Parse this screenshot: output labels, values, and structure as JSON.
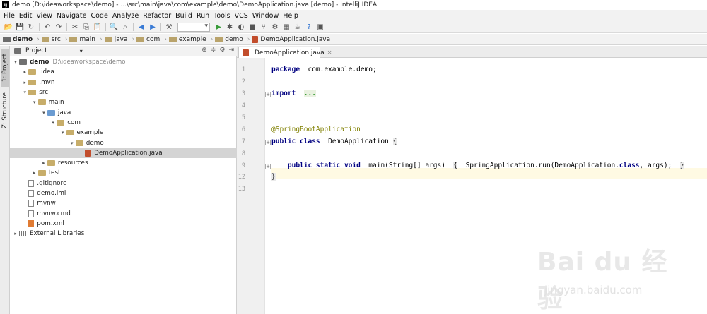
{
  "window": {
    "title": "demo [D:\\ideaworkspace\\demo] - ...\\src\\main\\java\\com\\example\\demo\\DemoApplication.java [demo] - IntelliJ IDEA",
    "app_icon": "IJ"
  },
  "menu": [
    "File",
    "Edit",
    "View",
    "Navigate",
    "Code",
    "Analyze",
    "Refactor",
    "Build",
    "Run",
    "Tools",
    "VCS",
    "Window",
    "Help"
  ],
  "toolbar_icons": [
    "open-icon",
    "save-icon",
    "sync-icon",
    "undo-icon",
    "redo-icon",
    "cut-icon",
    "copy-icon",
    "paste-icon",
    "find-icon",
    "replace-icon",
    "back-icon",
    "forward-icon",
    "build-icon",
    "run-icon",
    "debug-icon",
    "coverage-icon",
    "stop-icon",
    "vcs-icon",
    "settings-icon",
    "project-structure-icon",
    "sdk-icon",
    "help-icon",
    "terminal-icon"
  ],
  "breadcrumbs": [
    {
      "label": "demo",
      "icon": "folder-icon",
      "bold": true
    },
    {
      "label": "src",
      "icon": "folder-icon"
    },
    {
      "label": "main",
      "icon": "folder-icon"
    },
    {
      "label": "java",
      "icon": "folder-icon"
    },
    {
      "label": "com",
      "icon": "folder-icon"
    },
    {
      "label": "example",
      "icon": "folder-icon"
    },
    {
      "label": "demo",
      "icon": "folder-icon"
    },
    {
      "label": "DemoApplication.java",
      "icon": "java-file-icon"
    }
  ],
  "side_tabs": {
    "project": "1: Project",
    "structure": "Z: Structure"
  },
  "project_panel": {
    "title": "Project",
    "tree": [
      {
        "label": "demo",
        "path": "D:\\ideaworkspace\\demo",
        "depth": 0,
        "toggle": "▾",
        "icon": "fold dark",
        "bold": true
      },
      {
        "label": ".idea",
        "depth": 1,
        "toggle": "▸",
        "icon": "fold"
      },
      {
        "label": ".mvn",
        "depth": 1,
        "toggle": "▸",
        "icon": "fold"
      },
      {
        "label": "src",
        "depth": 1,
        "toggle": "▾",
        "icon": "fold"
      },
      {
        "label": "main",
        "depth": 2,
        "toggle": "▾",
        "icon": "fold"
      },
      {
        "label": "java",
        "depth": 3,
        "toggle": "▾",
        "icon": "fold blue"
      },
      {
        "label": "com",
        "depth": 4,
        "toggle": "▾",
        "icon": "fold"
      },
      {
        "label": "example",
        "depth": 5,
        "toggle": "▾",
        "icon": "fold"
      },
      {
        "label": "demo",
        "depth": 6,
        "toggle": "▾",
        "icon": "fold"
      },
      {
        "label": "DemoApplication.java",
        "depth": 7,
        "toggle": "",
        "icon": "jfile",
        "selected": true
      },
      {
        "label": "resources",
        "depth": 3,
        "toggle": "▸",
        "icon": "fold"
      },
      {
        "label": "test",
        "depth": 2,
        "toggle": "▸",
        "icon": "fold"
      },
      {
        "label": ".gitignore",
        "depth": 1,
        "toggle": "",
        "icon": "txt"
      },
      {
        "label": "demo.iml",
        "depth": 1,
        "toggle": "",
        "icon": "txt"
      },
      {
        "label": "mvnw",
        "depth": 1,
        "toggle": "",
        "icon": "txt"
      },
      {
        "label": "mvnw.cmd",
        "depth": 1,
        "toggle": "",
        "icon": "txt"
      },
      {
        "label": "pom.xml",
        "depth": 1,
        "toggle": "",
        "icon": "xml"
      },
      {
        "label": "External Libraries",
        "depth": 0,
        "toggle": "▸",
        "icon": "lib"
      }
    ]
  },
  "editor": {
    "tab_label": "DemoApplication.java",
    "lines": [
      {
        "n": "1",
        "tokens": [
          [
            "kw",
            "package"
          ],
          [
            "",
            "  com.example.demo;"
          ]
        ]
      },
      {
        "n": "2",
        "tokens": []
      },
      {
        "n": "3",
        "tokens": [
          [
            "kw",
            "import"
          ],
          [
            "",
            "  "
          ],
          [
            "fold-txt",
            "..."
          ]
        ]
      },
      {
        "n": "4",
        "tokens": []
      },
      {
        "n": "5",
        "tokens": []
      },
      {
        "n": "6",
        "tokens": [
          [
            "ann",
            "@SpringBootApplication"
          ]
        ]
      },
      {
        "n": "7",
        "tokens": [
          [
            "kw",
            "public class"
          ],
          [
            "",
            "  DemoApplication "
          ],
          [
            "brk",
            "{"
          ]
        ]
      },
      {
        "n": "8",
        "tokens": []
      },
      {
        "n": "9",
        "tokens": [
          [
            "",
            "    "
          ],
          [
            "kw",
            "public static void"
          ],
          [
            "",
            "  main(String[] args)  "
          ],
          [
            "brk",
            "{"
          ],
          [
            "",
            "  SpringApplication.run(DemoApplication."
          ],
          [
            "kw",
            "class"
          ],
          [
            "",
            ", args);  "
          ],
          [
            "brk",
            "}"
          ]
        ]
      },
      {
        "n": "12",
        "tokens": [
          [
            "brk",
            "}"
          ]
        ]
      },
      {
        "n": "13",
        "tokens": []
      }
    ]
  },
  "watermark": {
    "brand": "Bai du 经验",
    "url": "jingyan.baidu.com"
  }
}
